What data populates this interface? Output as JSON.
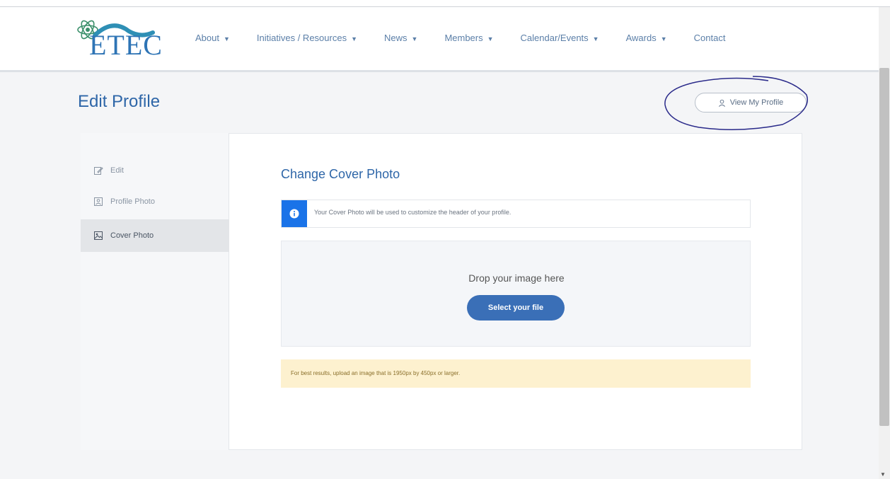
{
  "logo": {
    "text": "ETEC",
    "subtext": ""
  },
  "nav": {
    "items": [
      {
        "label": "About",
        "dropdown": true
      },
      {
        "label": "Initiatives / Resources",
        "dropdown": true
      },
      {
        "label": "News",
        "dropdown": true
      },
      {
        "label": "Members",
        "dropdown": true
      },
      {
        "label": "Calendar/Events",
        "dropdown": true
      },
      {
        "label": "Awards",
        "dropdown": true
      },
      {
        "label": "Contact",
        "dropdown": false
      }
    ],
    "caret": "▼"
  },
  "page": {
    "title": "Edit Profile",
    "view_profile_label": "View My Profile"
  },
  "sidebar": {
    "items": [
      {
        "label": "Edit",
        "icon": "edit-icon",
        "active": false
      },
      {
        "label": "Profile Photo",
        "icon": "profile-photo-icon",
        "active": false
      },
      {
        "label": "Cover Photo",
        "icon": "cover-photo-icon",
        "active": true
      }
    ]
  },
  "main": {
    "section_title": "Change Cover Photo",
    "info_text": "Your Cover Photo will be used to customize the header of your profile.",
    "drop_text": "Drop your image here",
    "select_label": "Select your file",
    "warning_text": "For best results, upload an image that is 1950px by 450px or larger."
  },
  "colors": {
    "accent": "#2e66a8",
    "button": "#3a6fb7",
    "info": "#1a73e8",
    "warning_bg": "#fdf1cf",
    "annotation_ink": "#2a2a8a"
  }
}
